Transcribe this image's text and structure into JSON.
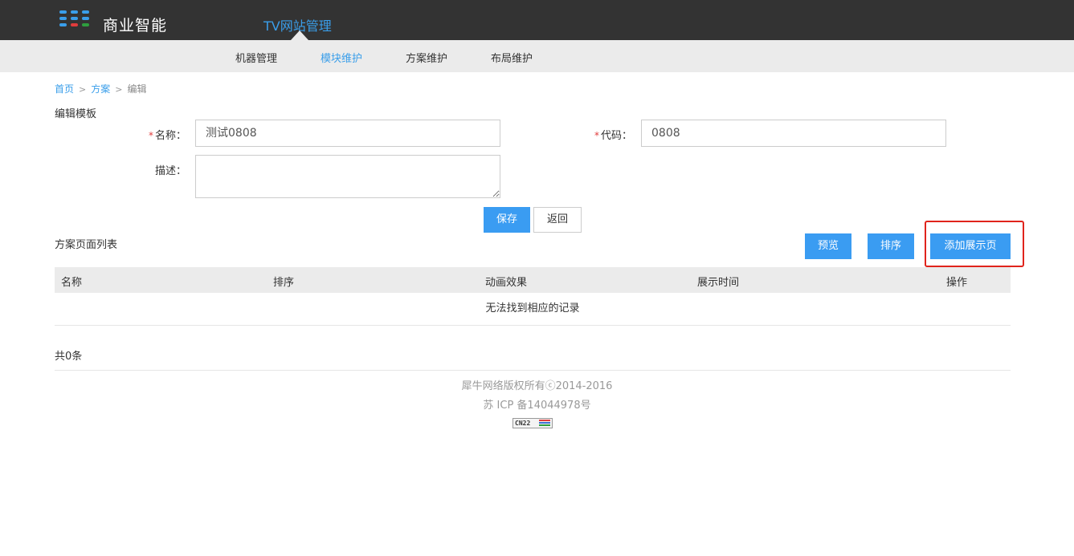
{
  "header": {
    "brand": "商业智能",
    "site_title": "TV网站管理",
    "logo_colors": [
      "#3a9eea",
      "#3a9eea",
      "#3a9eea",
      "#3a9eea",
      "#3a9eea",
      "#3a9eea",
      "#e03c3c",
      "#2e9e3e",
      "#3a9eea"
    ]
  },
  "subnav": {
    "items": [
      {
        "label": "机器管理"
      },
      {
        "label": "模块维护",
        "active": true
      },
      {
        "label": "方案维护"
      },
      {
        "label": "布局维护"
      }
    ]
  },
  "breadcrumb": {
    "home": "首页",
    "sep1": ">",
    "scheme": "方案",
    "sep2": ">",
    "current": "编辑"
  },
  "form": {
    "section_title": "编辑模板",
    "required_mark": "*",
    "name_label": "名称：",
    "name_value": "测试0808",
    "code_label": "代码：",
    "code_value": "0808",
    "desc_label": "描述：",
    "desc_value": "",
    "save_label": "保存",
    "back_label": "返回"
  },
  "pages": {
    "section_title": "方案页面列表",
    "preview_label": "预览",
    "sort_label": "排序",
    "add_label": "添加展示页",
    "columns": [
      "名称",
      "排序",
      "动画效果",
      "展示时间",
      "操作"
    ],
    "empty_text": "无法找到相应的记录",
    "count_text": "共0条"
  },
  "footer": {
    "copyright": "犀牛网络版权所有ⓒ2014-2016",
    "icp": "苏 ICP 备14044978号",
    "badge_text": "CN22"
  },
  "colors": {
    "accent": "#3a9cf2",
    "topbar": "#333333",
    "highlight": "#e0241c"
  }
}
